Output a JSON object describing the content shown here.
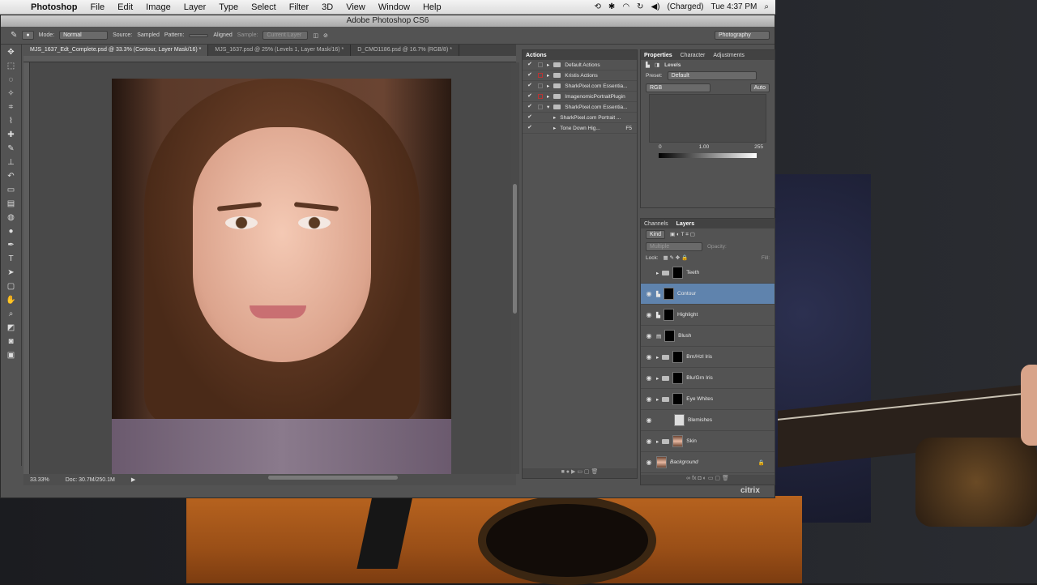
{
  "menubar": {
    "app": "Photoshop",
    "items": [
      "File",
      "Edit",
      "Image",
      "Layer",
      "Type",
      "Select",
      "Filter",
      "3D",
      "View",
      "Window",
      "Help"
    ],
    "battery": "(Charged)",
    "clock": "Tue 4:37 PM"
  },
  "window": {
    "title": "Adobe Photoshop CS6"
  },
  "options": {
    "mode_label": "Mode:",
    "mode_value": "Normal",
    "source_label": "Source:",
    "sampled": "Sampled",
    "pattern": "Pattern:",
    "aligned": "Aligned",
    "sample": "Sample:",
    "sample_value": "Current Layer",
    "workspace": "Photography"
  },
  "doc_tabs": [
    "MJS_1637_Edt_Complete.psd @ 33.3% (Contour, Layer Mask/16) *",
    "MJS_1637.psd @ 25% (Levels 1, Layer Mask/16) *",
    "D_CMO1186.psd @ 16.7% (RGB/8) *"
  ],
  "status": {
    "zoom": "33.33%",
    "doc": "Doc: 30.7M/250.1M"
  },
  "actions_panel": {
    "tab": "Actions",
    "rows": [
      {
        "label": "Default Actions"
      },
      {
        "label": "Kristis Actions"
      },
      {
        "label": "SharkPixel.com Essentia..."
      },
      {
        "label": "ImagenomicPortraitPlugin"
      },
      {
        "label": "SharkPixel.com Essentia..."
      },
      {
        "label": "SharkPixel.com Portrait ..."
      },
      {
        "label": "Tone Down Hig...",
        "shortcut": "F5"
      }
    ]
  },
  "properties_panel": {
    "tabs": [
      "Properties",
      "Character",
      "Adjustments"
    ],
    "adjustment": "Levels",
    "preset_label": "Preset:",
    "preset_value": "Default",
    "channel": "RGB",
    "auto": "Auto",
    "input_black": "0",
    "input_gamma": "1.00",
    "input_white": "255"
  },
  "layers_panel": {
    "tabs": [
      "Channels",
      "Layers"
    ],
    "kind": "Kind",
    "blend": "Multiple",
    "opacity_label": "Opacity:",
    "lock_label": "Lock:",
    "fill_label": "Fill:",
    "layers": [
      {
        "name": "Teeth",
        "kind": "group"
      },
      {
        "name": "Contour",
        "kind": "adjustment"
      },
      {
        "name": "Highlight",
        "kind": "adjustment"
      },
      {
        "name": "Blush",
        "kind": "adjustment"
      },
      {
        "name": "Brn/Hzl Iris",
        "kind": "group"
      },
      {
        "name": "Blu/Grn Iris",
        "kind": "group"
      },
      {
        "name": "Eye Whites",
        "kind": "group"
      },
      {
        "name": "Blemishes",
        "kind": "pixel"
      },
      {
        "name": "Skin",
        "kind": "group"
      },
      {
        "name": "Background",
        "kind": "photo"
      }
    ],
    "selected": "Contour"
  },
  "taskbar": {
    "brand": "citrix"
  }
}
